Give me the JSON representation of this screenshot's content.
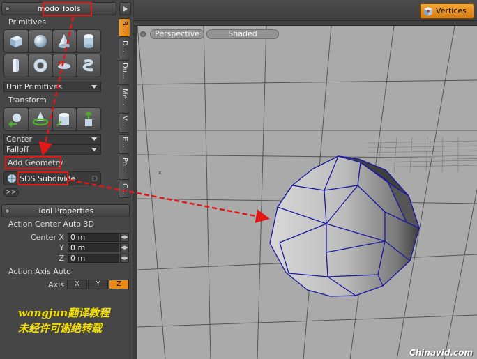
{
  "tools_panel": {
    "title": "modo Tools",
    "primitives_label": "Primitives",
    "unit_primitives": "Unit Primitives",
    "transform_label": "Transform",
    "center_dropdown": "Center",
    "falloff_dropdown": "Falloff",
    "add_geometry_label": "Add Geometry",
    "sds_subdivide_label": "SDS Subdivide",
    "sds_shortcut": "D",
    "more_label": ">>"
  },
  "vertical_tabs": [
    "B...",
    "D...",
    "Du...",
    "Me...",
    "V...",
    "E...",
    "Po...",
    "C..."
  ],
  "tool_properties": {
    "title": "Tool Properties",
    "action_center_label": "Action Center Auto 3D",
    "center_x_label": "Center X",
    "y_label": "Y",
    "z_label": "Z",
    "center_x_value": "0 m",
    "center_y_value": "0 m",
    "center_z_value": "0 m",
    "action_axis_label": "Action Axis Auto",
    "axis_label": "Axis",
    "axis_x": "X",
    "axis_y": "Y",
    "axis_z": "Z"
  },
  "watermark": {
    "line1": "wangjun翻译教程",
    "line2": "未经许可谢绝转载",
    "site": "Chinavid.com"
  },
  "top_bar": {
    "vertices_label": "Vertices"
  },
  "viewport": {
    "view_label": "Perspective",
    "shading_label": "Shaded"
  },
  "colors": {
    "accent_orange": "#e88a14",
    "annotation_red": "#e01818",
    "mesh_edge_blue": "#1a1aa0",
    "watermark_yellow": "#f4e000"
  }
}
